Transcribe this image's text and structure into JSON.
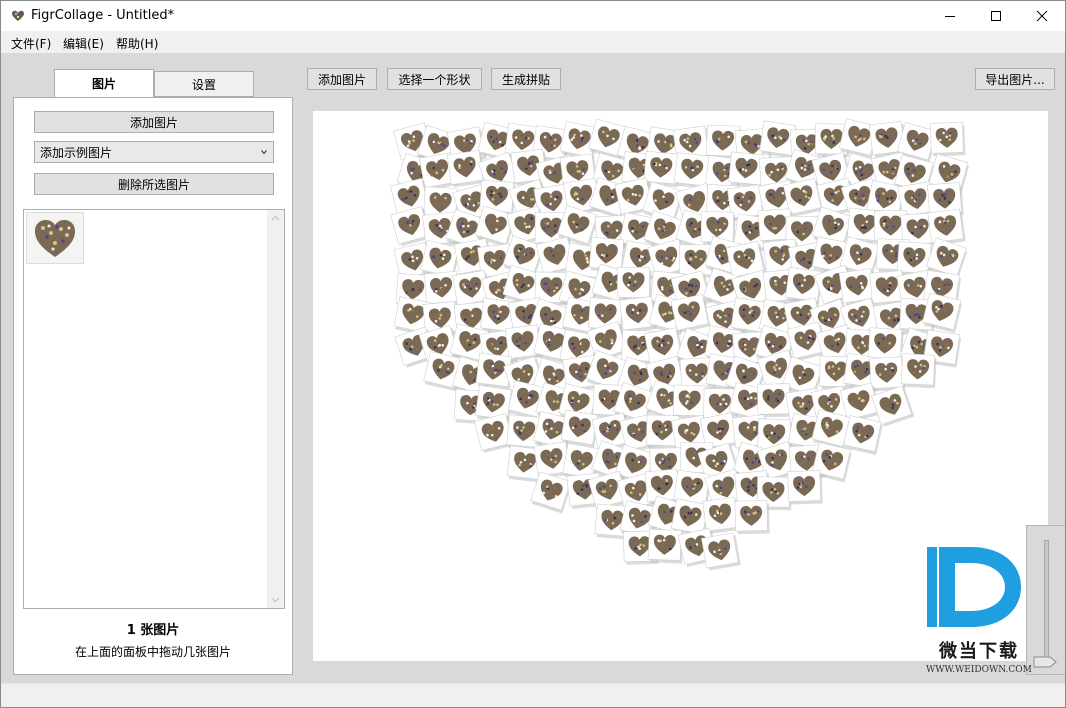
{
  "window": {
    "title": "FigrCollage - Untitled*",
    "controls": {
      "minimize": "minimize-icon",
      "maximize": "maximize-icon",
      "close": "close-icon"
    }
  },
  "menu": [
    "文件(F)",
    "编辑(E)",
    "帮助(H)"
  ],
  "tabs": [
    {
      "label": "图片",
      "active": true
    },
    {
      "label": "设置",
      "active": false
    }
  ],
  "panel": {
    "add_button": "添加图片",
    "sample_select": "添加示例图片",
    "delete_button": "删除所选图片",
    "count": "1 张图片",
    "hint": "在上面的面板中拖动几张图片"
  },
  "toolbar": {
    "add": "添加图片",
    "shape": "选择一个形状",
    "generate": "生成拼贴",
    "export": "导出图片..."
  },
  "watermark": {
    "text": "微当下载",
    "url": "WWW.WEIDOWN.COM"
  },
  "colors": {
    "client_bg": "#d9d9d9",
    "canvas_bg": "#ffffff",
    "watermark_blue": "#1f9ee0"
  }
}
